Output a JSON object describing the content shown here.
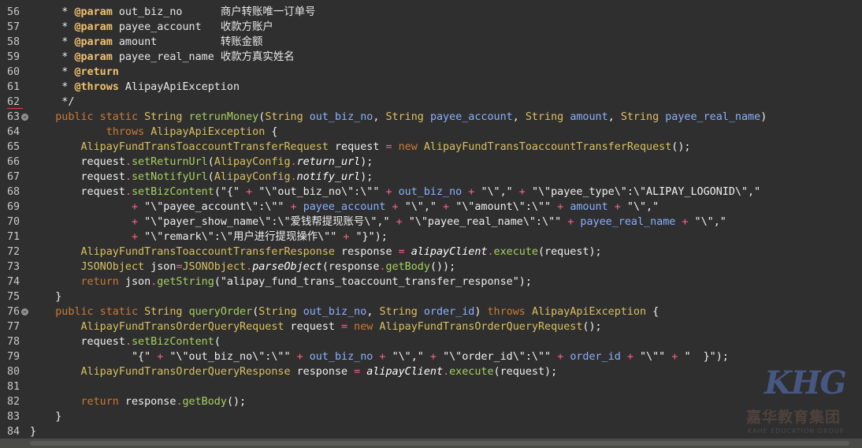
{
  "editor": {
    "lines": [
      {
        "n": "56",
        "fold": false,
        "err": false,
        "tokens": [
          [
            "c-com",
            "     * "
          ],
          [
            "c-tag",
            "@param"
          ],
          [
            "c-com",
            " out_biz_no      商户转账唯一订单号"
          ]
        ]
      },
      {
        "n": "57",
        "fold": false,
        "err": false,
        "tokens": [
          [
            "c-com",
            "     * "
          ],
          [
            "c-tag",
            "@param"
          ],
          [
            "c-com",
            " payee_account   收款方账户"
          ]
        ]
      },
      {
        "n": "58",
        "fold": false,
        "err": false,
        "tokens": [
          [
            "c-com",
            "     * "
          ],
          [
            "c-tag",
            "@param"
          ],
          [
            "c-com",
            " amount          转账金额"
          ]
        ]
      },
      {
        "n": "59",
        "fold": false,
        "err": false,
        "tokens": [
          [
            "c-com",
            "     * "
          ],
          [
            "c-tag",
            "@param"
          ],
          [
            "c-com",
            " payee_real_name 收款方真实姓名"
          ]
        ]
      },
      {
        "n": "60",
        "fold": false,
        "err": false,
        "tokens": [
          [
            "c-com",
            "     * "
          ],
          [
            "c-tag",
            "@return"
          ]
        ]
      },
      {
        "n": "61",
        "fold": false,
        "err": false,
        "tokens": [
          [
            "c-com",
            "     * "
          ],
          [
            "c-tag",
            "@throws"
          ],
          [
            "c-com",
            " AlipayApiException"
          ]
        ]
      },
      {
        "n": "62",
        "fold": false,
        "err": true,
        "tokens": [
          [
            "c-com",
            "     */"
          ]
        ]
      },
      {
        "n": "63",
        "fold": true,
        "err": false,
        "tokens": [
          [
            "c-kw",
            "    public static "
          ],
          [
            "c-type",
            "String"
          ],
          [
            "c-pl",
            " "
          ],
          [
            "c-fn",
            "retrunMoney"
          ],
          [
            "c-pl",
            "("
          ],
          [
            "c-type",
            "String"
          ],
          [
            "c-pl",
            " "
          ],
          [
            "c-id",
            "out_biz_no"
          ],
          [
            "c-pl",
            ", "
          ],
          [
            "c-type",
            "String"
          ],
          [
            "c-pl",
            " "
          ],
          [
            "c-id",
            "payee_account"
          ],
          [
            "c-pl",
            ", "
          ],
          [
            "c-type",
            "String"
          ],
          [
            "c-pl",
            " "
          ],
          [
            "c-id",
            "amount"
          ],
          [
            "c-pl",
            ", "
          ],
          [
            "c-type",
            "String"
          ],
          [
            "c-pl",
            " "
          ],
          [
            "c-id",
            "payee_real_name"
          ],
          [
            "c-pl",
            ")"
          ]
        ]
      },
      {
        "n": "64",
        "fold": false,
        "err": false,
        "tokens": [
          [
            "c-kw",
            "            throws "
          ],
          [
            "c-cls",
            "AlipayApiException"
          ],
          [
            "c-pl",
            " {"
          ]
        ]
      },
      {
        "n": "65",
        "fold": false,
        "err": false,
        "tokens": [
          [
            "c-cls",
            "        AlipayFundTransToaccountTransferRequest"
          ],
          [
            "c-pl",
            " request "
          ],
          [
            "c-op",
            "="
          ],
          [
            "c-kw",
            " new "
          ],
          [
            "c-cls",
            "AlipayFundTransToaccountTransferRequest"
          ],
          [
            "c-pl",
            "();"
          ]
        ]
      },
      {
        "n": "66",
        "fold": false,
        "err": false,
        "tokens": [
          [
            "c-pl",
            "        request"
          ],
          [
            "c-op",
            "."
          ],
          [
            "c-fn",
            "setReturnUrl"
          ],
          [
            "c-pl",
            "("
          ],
          [
            "c-cls",
            "AlipayConfig"
          ],
          [
            "c-op",
            "."
          ],
          [
            "c-fld",
            "return_url"
          ],
          [
            "c-pl",
            ");"
          ]
        ]
      },
      {
        "n": "67",
        "fold": false,
        "err": false,
        "tokens": [
          [
            "c-pl",
            "        request"
          ],
          [
            "c-op",
            "."
          ],
          [
            "c-fn",
            "setNotifyUrl"
          ],
          [
            "c-pl",
            "("
          ],
          [
            "c-cls",
            "AlipayConfig"
          ],
          [
            "c-op",
            "."
          ],
          [
            "c-fld",
            "notify_url"
          ],
          [
            "c-pl",
            ");"
          ]
        ]
      },
      {
        "n": "68",
        "fold": false,
        "err": false,
        "tokens": [
          [
            "c-pl",
            "        request"
          ],
          [
            "c-op",
            "."
          ],
          [
            "c-fn",
            "setBizContent"
          ],
          [
            "c-pl",
            "("
          ],
          [
            "c-str",
            "\"{\""
          ],
          [
            "c-op",
            " + "
          ],
          [
            "c-str",
            "\"\\\"out_biz_no\\\":\\\"\""
          ],
          [
            "c-op",
            " + "
          ],
          [
            "c-id",
            "out_biz_no"
          ],
          [
            "c-op",
            " + "
          ],
          [
            "c-str",
            "\"\\\",\""
          ],
          [
            "c-op",
            " + "
          ],
          [
            "c-str",
            "\"\\\"payee_type\\\":\\\"ALIPAY_LOGONID\\\",\""
          ]
        ]
      },
      {
        "n": "69",
        "fold": false,
        "err": false,
        "tokens": [
          [
            "c-op",
            "                + "
          ],
          [
            "c-str",
            "\"\\\"payee_account\\\":\\\"\""
          ],
          [
            "c-op",
            " + "
          ],
          [
            "c-id",
            "payee_account"
          ],
          [
            "c-op",
            " + "
          ],
          [
            "c-str",
            "\"\\\",\""
          ],
          [
            "c-op",
            " + "
          ],
          [
            "c-str",
            "\"\\\"amount\\\":\\\"\""
          ],
          [
            "c-op",
            " + "
          ],
          [
            "c-id",
            "amount"
          ],
          [
            "c-op",
            " + "
          ],
          [
            "c-str",
            "\"\\\",\""
          ]
        ]
      },
      {
        "n": "70",
        "fold": false,
        "err": false,
        "tokens": [
          [
            "c-op",
            "                + "
          ],
          [
            "c-str",
            "\"\\\"payer_show_name\\\":\\\"爱钱帮提现账号\\\",\""
          ],
          [
            "c-op",
            " + "
          ],
          [
            "c-str",
            "\"\\\"payee_real_name\\\":\\\"\""
          ],
          [
            "c-op",
            " + "
          ],
          [
            "c-id",
            "payee_real_name"
          ],
          [
            "c-op",
            " + "
          ],
          [
            "c-str",
            "\"\\\",\""
          ]
        ]
      },
      {
        "n": "71",
        "fold": false,
        "err": false,
        "tokens": [
          [
            "c-op",
            "                + "
          ],
          [
            "c-str",
            "\"\\\"remark\\\":\\\"用户进行提现操作\\\"\""
          ],
          [
            "c-op",
            " + "
          ],
          [
            "c-str",
            "\"}\""
          ],
          [
            "c-pl",
            ");"
          ]
        ]
      },
      {
        "n": "72",
        "fold": false,
        "err": false,
        "tokens": [
          [
            "c-cls",
            "        AlipayFundTransToaccountTransferResponse"
          ],
          [
            "c-pl",
            " response "
          ],
          [
            "c-op",
            "="
          ],
          [
            "c-pl",
            " "
          ],
          [
            "c-fld",
            "alipayClient"
          ],
          [
            "c-op",
            "."
          ],
          [
            "c-fn",
            "execute"
          ],
          [
            "c-pl",
            "(request);"
          ]
        ]
      },
      {
        "n": "73",
        "fold": false,
        "err": false,
        "tokens": [
          [
            "c-cls",
            "        JSONObject"
          ],
          [
            "c-pl",
            " json"
          ],
          [
            "c-op",
            "="
          ],
          [
            "c-cls",
            "JSONObject"
          ],
          [
            "c-op",
            "."
          ],
          [
            "c-fld",
            "parseObject"
          ],
          [
            "c-pl",
            "(response"
          ],
          [
            "c-op",
            "."
          ],
          [
            "c-fn",
            "getBody"
          ],
          [
            "c-pl",
            "());"
          ]
        ]
      },
      {
        "n": "74",
        "fold": false,
        "err": false,
        "tokens": [
          [
            "c-kw",
            "        return"
          ],
          [
            "c-pl",
            " json"
          ],
          [
            "c-op",
            "."
          ],
          [
            "c-fn",
            "getString"
          ],
          [
            "c-pl",
            "("
          ],
          [
            "c-str",
            "\"alipay_fund_trans_toaccount_transfer_response\""
          ],
          [
            "c-pl",
            ");"
          ]
        ]
      },
      {
        "n": "75",
        "fold": false,
        "err": false,
        "tokens": [
          [
            "c-pl",
            "    }"
          ]
        ]
      },
      {
        "n": "76",
        "fold": true,
        "err": false,
        "tokens": [
          [
            "c-kw",
            "    public static "
          ],
          [
            "c-type",
            "String"
          ],
          [
            "c-pl",
            " "
          ],
          [
            "c-fn",
            "queryOrder"
          ],
          [
            "c-pl",
            "("
          ],
          [
            "c-type",
            "String"
          ],
          [
            "c-pl",
            " "
          ],
          [
            "c-id",
            "out_biz_no"
          ],
          [
            "c-pl",
            ", "
          ],
          [
            "c-type",
            "String"
          ],
          [
            "c-pl",
            " "
          ],
          [
            "c-id",
            "order_id"
          ],
          [
            "c-pl",
            ") "
          ],
          [
            "c-kw",
            "throws "
          ],
          [
            "c-cls",
            "AlipayApiException"
          ],
          [
            "c-pl",
            " {"
          ]
        ]
      },
      {
        "n": "77",
        "fold": false,
        "err": false,
        "tokens": [
          [
            "c-cls",
            "        AlipayFundTransOrderQueryRequest"
          ],
          [
            "c-pl",
            " request "
          ],
          [
            "c-op",
            "="
          ],
          [
            "c-kw",
            " new "
          ],
          [
            "c-cls",
            "AlipayFundTransOrderQueryRequest"
          ],
          [
            "c-pl",
            "();"
          ]
        ]
      },
      {
        "n": "78",
        "fold": false,
        "err": false,
        "tokens": [
          [
            "c-pl",
            "        request"
          ],
          [
            "c-op",
            "."
          ],
          [
            "c-fn",
            "setBizContent"
          ],
          [
            "c-pl",
            "("
          ]
        ]
      },
      {
        "n": "79",
        "fold": false,
        "err": false,
        "tokens": [
          [
            "c-str",
            "                \"{\""
          ],
          [
            "c-op",
            " + "
          ],
          [
            "c-str",
            "\"\\\"out_biz_no\\\":\\\"\""
          ],
          [
            "c-op",
            " + "
          ],
          [
            "c-id",
            "out_biz_no"
          ],
          [
            "c-op",
            " + "
          ],
          [
            "c-str",
            "\"\\\",\""
          ],
          [
            "c-op",
            " + "
          ],
          [
            "c-str",
            "\"\\\"order_id\\\":\\\"\""
          ],
          [
            "c-op",
            " + "
          ],
          [
            "c-id",
            "order_id"
          ],
          [
            "c-op",
            " + "
          ],
          [
            "c-str",
            "\"\\\"\""
          ],
          [
            "c-op",
            " + "
          ],
          [
            "c-str",
            "\"  }\""
          ],
          [
            "c-pl",
            ");"
          ]
        ]
      },
      {
        "n": "80",
        "fold": false,
        "err": false,
        "tokens": [
          [
            "c-cls",
            "        AlipayFundTransOrderQueryResponse"
          ],
          [
            "c-pl",
            " response "
          ],
          [
            "c-op",
            "="
          ],
          [
            "c-pl",
            " "
          ],
          [
            "c-fld",
            "alipayClient"
          ],
          [
            "c-op",
            "."
          ],
          [
            "c-fn",
            "execute"
          ],
          [
            "c-pl",
            "(request);"
          ]
        ]
      },
      {
        "n": "81",
        "fold": false,
        "err": false,
        "tokens": []
      },
      {
        "n": "82",
        "fold": false,
        "err": false,
        "tokens": [
          [
            "c-kw",
            "        return"
          ],
          [
            "c-pl",
            " response"
          ],
          [
            "c-op",
            "."
          ],
          [
            "c-fn",
            "getBody"
          ],
          [
            "c-pl",
            "();"
          ]
        ]
      },
      {
        "n": "83",
        "fold": false,
        "err": false,
        "tokens": [
          [
            "c-pl",
            "    }"
          ]
        ]
      },
      {
        "n": "84",
        "fold": false,
        "err": false,
        "tokens": [
          [
            "c-pl",
            "}"
          ]
        ]
      }
    ]
  },
  "watermark": {
    "logo": "KHG",
    "name": "嘉华教育集团",
    "sub": "KAHE EDUCATION GROUP"
  }
}
